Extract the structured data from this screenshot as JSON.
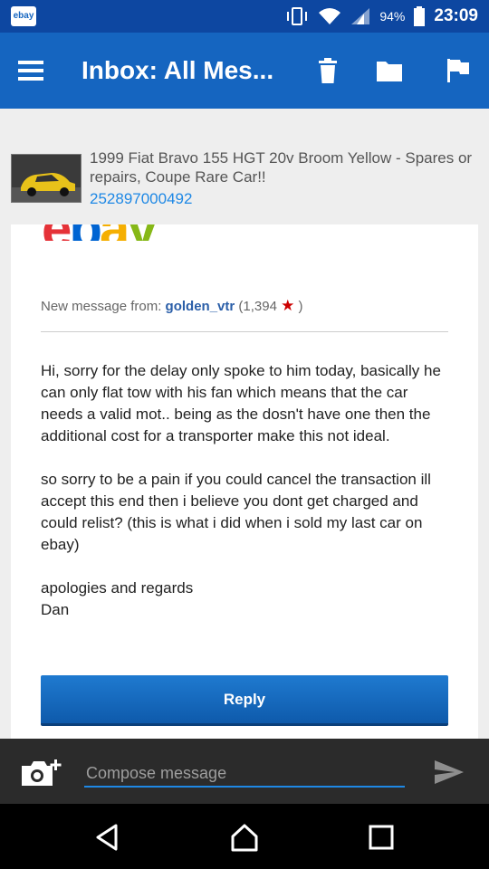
{
  "status_bar": {
    "app_badge": "ebay",
    "battery": "94%",
    "time": "23:09"
  },
  "app_bar": {
    "title": "Inbox: All Mes..."
  },
  "item": {
    "title": "1999 Fiat Bravo 155 HGT 20v Broom Yellow - Spares or repairs, Coupe Rare Car!!",
    "id": "252897000492"
  },
  "message": {
    "logo": [
      "e",
      "b",
      "a",
      "y"
    ],
    "from_label": "New message from:",
    "sender": "golden_vtr",
    "feedback_open": "(1,394",
    "feedback_close": ")",
    "paragraphs": [
      "Hi, sorry for the delay only spoke to him today, basically he can only flat tow with his fan which means that the car needs a valid mot.. being as the dosn't have one then the additional cost for a transporter make this not ideal.",
      "so sorry to be a pain if you could cancel the transaction ill accept this end then i believe you dont get charged and could relist? (this is what i did when i sold my last car on ebay)",
      "apologies and regards"
    ],
    "signature": "Dan",
    "reply_label": "Reply"
  },
  "compose": {
    "placeholder": "Compose message",
    "value": ""
  },
  "colors": {
    "status_bar": "#0d47a1",
    "app_bar": "#1565c0",
    "link_blue": "#1e88e5",
    "star_red": "#cc0000"
  },
  "icons": {
    "toolbar": [
      "menu-icon",
      "delete-icon",
      "folder-icon",
      "flag-icon"
    ],
    "nav": [
      "back-icon",
      "home-icon",
      "recent-apps-icon"
    ]
  }
}
